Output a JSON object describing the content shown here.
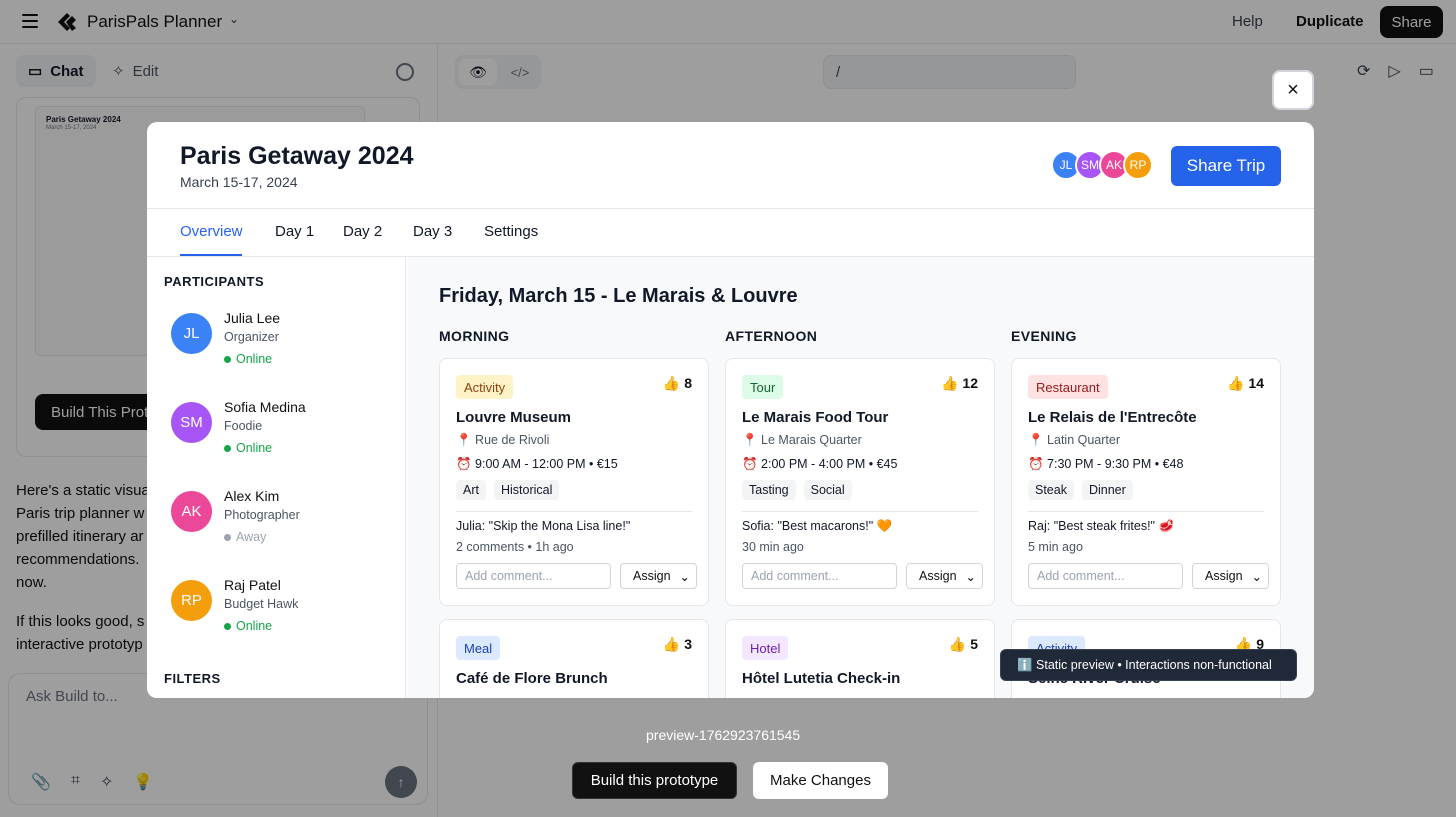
{
  "app": {
    "project_name": "ParisPals Planner",
    "help": "Help",
    "duplicate": "Duplicate",
    "share": "Share"
  },
  "left_panel": {
    "chat_tab": "Chat",
    "edit_tab": "Edit",
    "thumbnail": {
      "title": "Paris Getaway 2024",
      "subtitle": "March 15-17, 2024"
    },
    "build_button": "Build This Prot",
    "message_lines": [
      "Here's a static visua",
      "Paris trip planner w",
      "prefilled itinerary ar",
      "recommendations.",
      "now."
    ],
    "message2_lines": [
      "If this looks good, s",
      "interactive prototyp"
    ],
    "ask_placeholder": "Ask Build to..."
  },
  "preview": {
    "url": "/",
    "label": "preview-1762923761545",
    "build_button": "Build this prototype",
    "make_changes_button": "Make Changes",
    "close": "×",
    "tooltip": "ℹ️ Static preview • Interactions non-functional"
  },
  "modal": {
    "title": "Paris Getaway 2024",
    "dates": "March 15-17, 2024",
    "avatars": [
      {
        "initials": "JL",
        "color": "#3b82f6"
      },
      {
        "initials": "SM",
        "color": "#a855f7"
      },
      {
        "initials": "AK",
        "color": "#ec4899"
      },
      {
        "initials": "RP",
        "color": "#f59e0b"
      }
    ],
    "share_trip": "Share Trip",
    "tabs": [
      "Overview",
      "Day 1",
      "Day 2",
      "Day 3",
      "Settings"
    ],
    "participants_heading": "PARTICIPANTS",
    "filters_heading": "FILTERS",
    "participants": [
      {
        "initials": "JL",
        "name": "Julia Lee",
        "role": "Organizer",
        "status": "Online",
        "color": "#3b82f6",
        "status_color": "#16a34a"
      },
      {
        "initials": "SM",
        "name": "Sofia Medina",
        "role": "Foodie",
        "status": "Online",
        "color": "#a855f7",
        "status_color": "#16a34a"
      },
      {
        "initials": "AK",
        "name": "Alex Kim",
        "role": "Photographer",
        "status": "Away",
        "color": "#ec4899",
        "status_color": "#9ca3af"
      },
      {
        "initials": "RP",
        "name": "Raj Patel",
        "role": "Budget Hawk",
        "status": "Online",
        "color": "#f59e0b",
        "status_color": "#16a34a"
      }
    ],
    "day_title": "Friday, March 15 - Le Marais & Louvre",
    "columns": [
      "MORNING",
      "AFTERNOON",
      "EVENING"
    ],
    "cards": [
      {
        "badge": "Activity",
        "badge_bg": "#fef3c7",
        "badge_fg": "#92400e",
        "likes": "👍 8",
        "title": "Louvre Museum",
        "location": "📍 Rue de Rivoli",
        "time": "⏰ 9:00 AM - 12:00 PM  •  €15",
        "tags": [
          "Art",
          "Historical"
        ],
        "comment_author": "Julia:",
        "comment": " \"Skip the Mona Lisa line!\"",
        "meta": "2 comments • 1h ago",
        "input_placeholder": "Add comment...",
        "assign": "Assign"
      },
      {
        "badge": "Tour",
        "badge_bg": "#dcfce7",
        "badge_fg": "#166534",
        "likes": "👍 12",
        "title": "Le Marais Food Tour",
        "location": "📍 Le Marais Quarter",
        "time": "⏰ 2:00 PM - 4:00 PM  •  €45",
        "tags": [
          "Tasting",
          "Social"
        ],
        "comment_author": "Sofia:",
        "comment": " \"Best macarons!\" 🧡",
        "meta": "30 min ago",
        "input_placeholder": "Add comment...",
        "assign": "Assign"
      },
      {
        "badge": "Restaurant",
        "badge_bg": "#fee2e2",
        "badge_fg": "#991b1b",
        "likes": "👍 14",
        "title": "Le Relais de l'Entrecôte",
        "location": "📍 Latin Quarter",
        "time": "⏰ 7:30 PM - 9:30 PM  •  €48",
        "tags": [
          "Steak",
          "Dinner"
        ],
        "comment_author": "Raj:",
        "comment": " \"Best steak frites!\" 🥩",
        "meta": "5 min ago",
        "input_placeholder": "Add comment...",
        "assign": "Assign"
      },
      {
        "badge": "Meal",
        "badge_bg": "#dbeafe",
        "badge_fg": "#1e40af",
        "likes": "👍 3",
        "title": "Café de Flore Brunch"
      },
      {
        "badge": "Hotel",
        "badge_bg": "#f3e8ff",
        "badge_fg": "#6b21a8",
        "likes": "👍 5",
        "title": "Hôtel Lutetia Check-in"
      },
      {
        "badge": "Activity",
        "badge_bg": "#dbeafe",
        "badge_fg": "#1e40af",
        "likes": "👍 9",
        "title": "Seine River Cruise"
      }
    ]
  }
}
